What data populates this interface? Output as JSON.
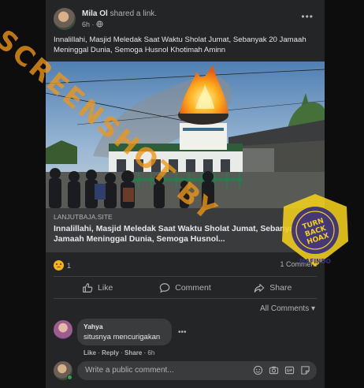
{
  "post": {
    "author": "Mila Ol",
    "action": "shared a link.",
    "time": "6h",
    "more": "•••",
    "text": "Innalillahi, Masjid Meledak Saat Waktu Sholat Jumat, Sebanyak 20 Jamaah Meninggal Dunia, Semoga Husnol Khotimah Aminn"
  },
  "link_preview": {
    "site": "LANJUTBAJA.SITE",
    "title": "Innalillahi, Masjid Meledak Saat Waktu Sholat Jumat, Sebanyak 20 Jamaah Meninggal Dunia, Semoga Husnol..."
  },
  "reactions": {
    "count": "1",
    "comments": "1 Comment"
  },
  "actions": {
    "like": "Like",
    "comment": "Comment",
    "share": "Share"
  },
  "comments": {
    "sort_label": "All Comments ▾",
    "items": [
      {
        "name": "Yahya",
        "text": "situsnya mencurigakan",
        "more": "•••",
        "like": "Like",
        "reply": "Reply",
        "share": "Share",
        "time": "6h"
      }
    ],
    "write_placeholder": "Write a public comment..."
  },
  "watermark": {
    "text": "SCREENSHOT BY",
    "stamp_top": "MASYARAKAT ANTI FITNAH INDONESIA",
    "stamp_center": "TURN BACK HOAX",
    "stamp_bottom": "MAFINDO"
  },
  "colors": {
    "card_bg": "#242526",
    "page_bg": "#0d0d0e",
    "watermark_orange": "#f0a020",
    "stamp_yellow": "#f2d21b",
    "stamp_purple": "#3c2f7d"
  }
}
